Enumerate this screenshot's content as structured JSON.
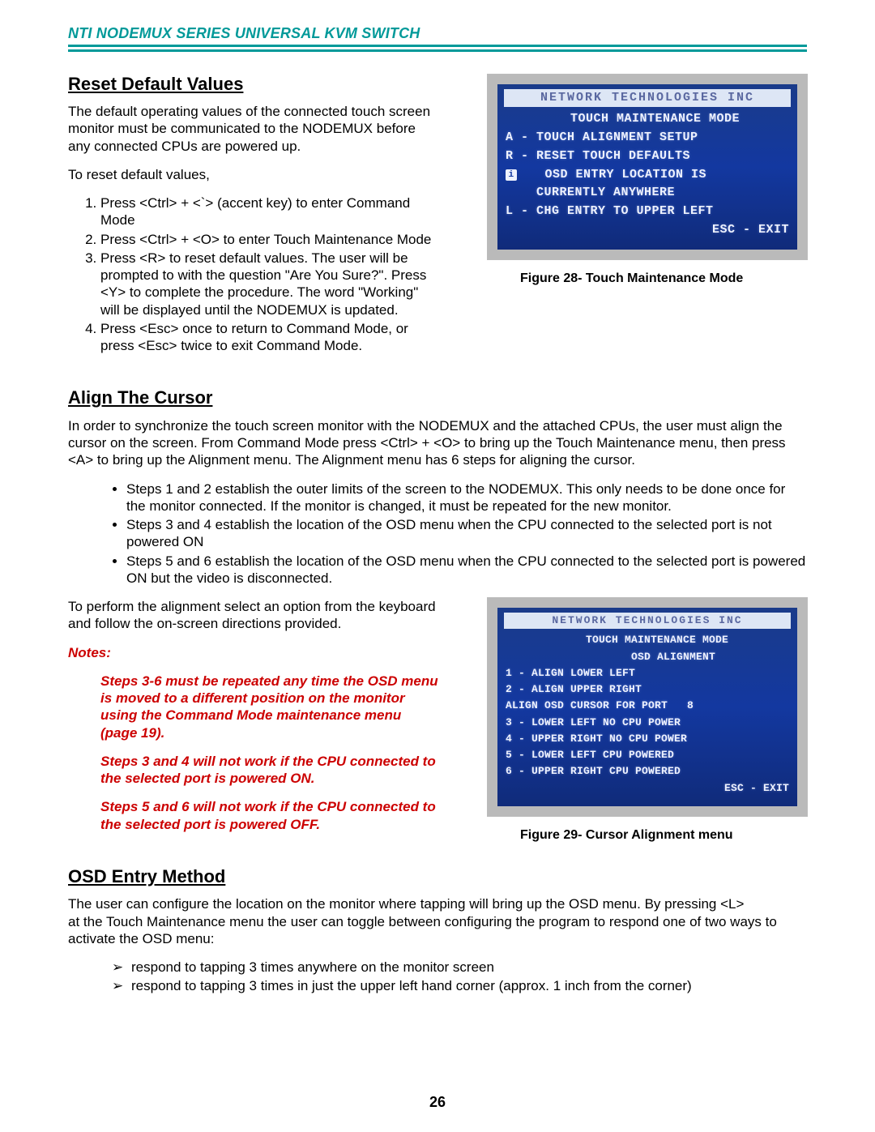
{
  "header": {
    "title": "NTI NODEMUX SERIES UNIVERSAL KVM SWITCH"
  },
  "reset": {
    "heading": "Reset Default Values",
    "para1": "The default operating values of the connected touch screen monitor must be communicated to the NODEMUX before any connected CPUs are powered up.",
    "para2": "To reset default values,",
    "steps": [
      "Press <Ctrl> + <`> (accent key) to enter Command Mode",
      "Press <Ctrl> + <O> to enter Touch Maintenance Mode",
      "Press <R> to reset default values.       The user will be prompted to with the question \"Are You Sure?\".    Press <Y> to complete the procedure.   The word \"Working\" will be displayed until the NODEMUX is updated.",
      "Press <Esc> once to return to Command Mode,  or press <Esc> twice to exit Command Mode."
    ]
  },
  "fig28": {
    "caption": "Figure 28- Touch Maintenance Mode",
    "title": "NETWORK TECHNOLOGIES INC",
    "lines": [
      "  TOUCH MAINTENANCE MODE",
      "",
      "A - TOUCH ALIGNMENT SETUP",
      "",
      "R - RESET TOUCH DEFAULTS",
      "",
      "   OSD ENTRY LOCATION IS",
      "    CURRENTLY ANYWHERE",
      "",
      "L - CHG ENTRY TO UPPER LEFT",
      "",
      "                 ESC - EXIT"
    ]
  },
  "align": {
    "heading": "Align The Cursor",
    "para1": "In order to synchronize the touch screen monitor with the NODEMUX and the attached CPUs,  the user must align the cursor on the screen.    From Command Mode press <Ctrl> + <O> to bring up the Touch Maintenance menu, then press <A> to bring up the Alignment menu.     The Alignment menu has 6 steps for aligning the cursor.",
    "bullets": [
      "Steps 1 and 2 establish the outer limits of the screen to the NODEMUX.    This only needs to be done once for the monitor connected.     If the monitor is changed, it must be repeated for the new monitor.",
      "Steps 3 and 4 establish the location of the OSD menu when the CPU connected to the selected port is not powered ON",
      "Steps 5 and 6 establish the location of the OSD menu when the CPU connected to the selected port is powered ON but the video is disconnected."
    ],
    "para2": "To perform the alignment select an option from the keyboard and follow the on-screen directions provided.",
    "notes_label": "Notes:",
    "notes": [
      "Steps 3-6 must be repeated any time the OSD menu is moved to a different position on the monitor using the Command Mode maintenance menu (page 19).",
      "Steps 3 and 4 will not work if the CPU connected to the selected port is powered ON.",
      "Steps 5 and 6 will not work if the CPU connected to the selected port is powered OFF."
    ]
  },
  "fig29": {
    "caption": "Figure 29- Cursor Alignment menu",
    "title": "NETWORK TECHNOLOGIES INC",
    "lines": [
      "   TOUCH MAINTENANCE MODE",
      "        OSD ALIGNMENT",
      "",
      "1 - ALIGN LOWER LEFT",
      "2 - ALIGN UPPER RIGHT",
      "",
      "ALIGN OSD CURSOR FOR PORT   8",
      "",
      "3 - LOWER LEFT NO CPU POWER",
      "4 - UPPER RIGHT NO CPU POWER",
      "5 - LOWER LEFT CPU POWERED",
      "6 - UPPER RIGHT CPU POWERED",
      "               ESC - EXIT"
    ]
  },
  "osd": {
    "heading": "OSD Entry Method",
    "para1": "The user can configure the location on the monitor where tapping will bring up the OSD menu.   By pressing <L>",
    "para2": "at the Touch Maintenance menu the user can toggle between configuring the program to respond one of two ways to activate the OSD menu:",
    "items": [
      "respond to tapping 3 times anywhere on the monitor screen",
      "respond to tapping 3 times in just the upper left hand corner (approx. 1 inch from the corner)"
    ]
  },
  "page_number": "26"
}
